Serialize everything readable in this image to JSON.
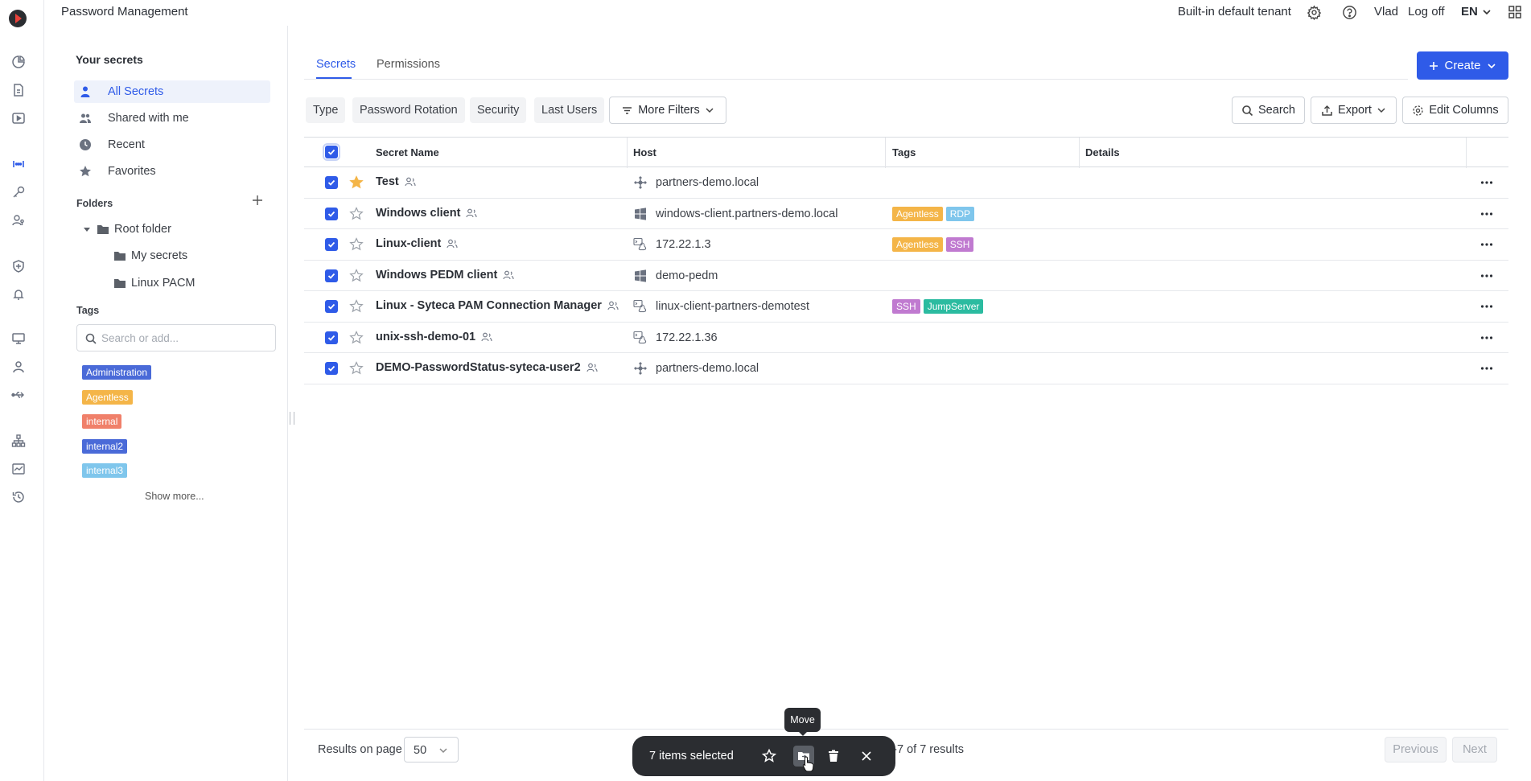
{
  "app": {
    "title": "Password Management",
    "tenant": "Built-in default tenant",
    "user": "Vlad",
    "logoff": "Log off",
    "language": "EN"
  },
  "rail_icons": [
    "dashboard-icon",
    "reports-icon",
    "sessions-icon",
    "password-icon",
    "keys-icon",
    "users-key-icon",
    "shield-icon",
    "alerts-icon",
    "monitor-icon",
    "user-icon",
    "usb-icon",
    "network-icon",
    "analytics-icon",
    "history-icon"
  ],
  "sidebar": {
    "heading": "Your secrets",
    "items": [
      {
        "label": "All Secrets",
        "icon": "person-icon",
        "active": true
      },
      {
        "label": "Shared with me",
        "icon": "people-icon",
        "active": false
      },
      {
        "label": "Recent",
        "icon": "clock-icon",
        "active": false
      },
      {
        "label": "Favorites",
        "icon": "star-icon",
        "active": false
      }
    ],
    "folders_heading": "Folders",
    "folders": [
      {
        "label": "Root folder",
        "expanded": true
      },
      {
        "label": "My secrets"
      },
      {
        "label": "Linux PACM"
      }
    ],
    "tags_heading": "Tags",
    "tag_search_placeholder": "Search or add...",
    "tags": [
      {
        "label": "Administration",
        "color": "#4a6ad8"
      },
      {
        "label": "Agentless",
        "color": "#f4b548"
      },
      {
        "label": "internal",
        "color": "#f0806a"
      },
      {
        "label": "internal2",
        "color": "#4a6ad8"
      },
      {
        "label": "internal3",
        "color": "#7fc6ec"
      }
    ],
    "show_more": "Show more..."
  },
  "tabs": [
    {
      "label": "Secrets",
      "active": true
    },
    {
      "label": "Permissions",
      "active": false
    }
  ],
  "create_label": "Create",
  "filters": [
    "Type",
    "Password Rotation",
    "Security",
    "Last Users"
  ],
  "more_filters_label": "More Filters",
  "search_label": "Search",
  "export_label": "Export",
  "edit_columns_label": "Edit Columns",
  "table": {
    "columns": [
      "Secret Name",
      "Host",
      "Tags",
      "Details"
    ],
    "rows": [
      {
        "name": "Test",
        "favorite": true,
        "host_icon": "network-icon",
        "host": "partners-demo.local",
        "tags": []
      },
      {
        "name": "Windows client",
        "favorite": false,
        "host_icon": "windows-icon",
        "host": "windows-client.partners-demo.local",
        "tags": [
          {
            "label": "Agentless",
            "color": "#f4b548"
          },
          {
            "label": "RDP",
            "color": "#7fc6ec"
          }
        ]
      },
      {
        "name": "Linux-client",
        "favorite": false,
        "host_icon": "linux-icon",
        "host": "172.22.1.3",
        "tags": [
          {
            "label": "Agentless",
            "color": "#f4b548"
          },
          {
            "label": "SSH",
            "color": "#c07ad0"
          }
        ]
      },
      {
        "name": "Windows PEDM client",
        "favorite": false,
        "host_icon": "windows-icon",
        "host": "demo-pedm",
        "tags": []
      },
      {
        "name": "Linux - Syteca PAM Connection Manager",
        "favorite": false,
        "host_icon": "linux-icon",
        "host": "linux-client-partners-demotest",
        "tags": [
          {
            "label": "SSH",
            "color": "#c07ad0"
          },
          {
            "label": "JumpServer",
            "color": "#2bbba0"
          }
        ]
      },
      {
        "name": "unix-ssh-demo-01",
        "favorite": false,
        "host_icon": "linux-icon",
        "host": "172.22.1.36",
        "tags": []
      },
      {
        "name": "DEMO-PasswordStatus-syteca-user2",
        "favorite": false,
        "host_icon": "network-icon",
        "host": "partners-demo.local",
        "tags": []
      }
    ]
  },
  "footer": {
    "results_on_page_label": "Results on page",
    "results_on_page_value": "50",
    "results_text": "g 1-7 of 7 results",
    "previous": "Previous",
    "next": "Next"
  },
  "selection": {
    "count_text": "7 items selected",
    "tooltip": "Move"
  }
}
